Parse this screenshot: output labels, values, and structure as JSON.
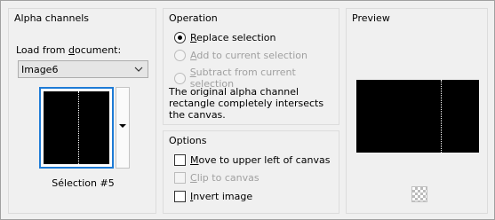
{
  "alpha_channels": {
    "title": "Alpha channels",
    "load_label_prefix": "Load from ",
    "load_label_underlined": "d",
    "load_label_suffix": "ocument:",
    "document_value": "Image6",
    "selection_label": "Sélection #5"
  },
  "operation": {
    "title": "Operation",
    "options": [
      {
        "underlined": "R",
        "rest": "eplace selection",
        "selected": true,
        "enabled": true
      },
      {
        "underlined": "A",
        "rest": "dd to current selection",
        "selected": false,
        "enabled": false
      },
      {
        "underlined": "S",
        "rest": "ubtract from current selection",
        "selected": false,
        "enabled": false
      }
    ],
    "description": "The original alpha channel rectangle completely intersects the canvas."
  },
  "options": {
    "title": "Options",
    "items": [
      {
        "underlined": "M",
        "rest": "ove to upper left of canvas",
        "checked": false,
        "enabled": true
      },
      {
        "underlined": "C",
        "rest": "lip to canvas",
        "checked": false,
        "enabled": false
      },
      {
        "underlined": "I",
        "rest": "nvert image",
        "checked": false,
        "enabled": true
      }
    ]
  },
  "preview": {
    "title": "Preview",
    "background_icon": "checkerboard-icon"
  }
}
